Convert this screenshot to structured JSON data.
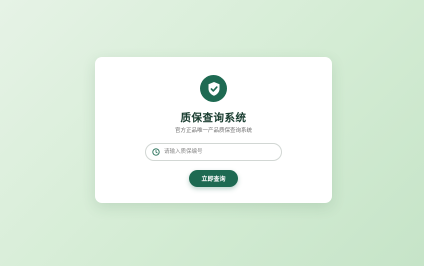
{
  "card": {
    "title": "质保查询系统",
    "subtitle": "官方正品唯一产品质保查询系统"
  },
  "search": {
    "placeholder": "请输入质保编号",
    "value": ""
  },
  "query_button": {
    "label": "立即查询"
  },
  "icons": {
    "logo": "shield-check-icon",
    "input": "clock-icon"
  },
  "colors": {
    "accent": "#1e6a52",
    "background": "#d4ecd4",
    "title": "#173b2e"
  }
}
